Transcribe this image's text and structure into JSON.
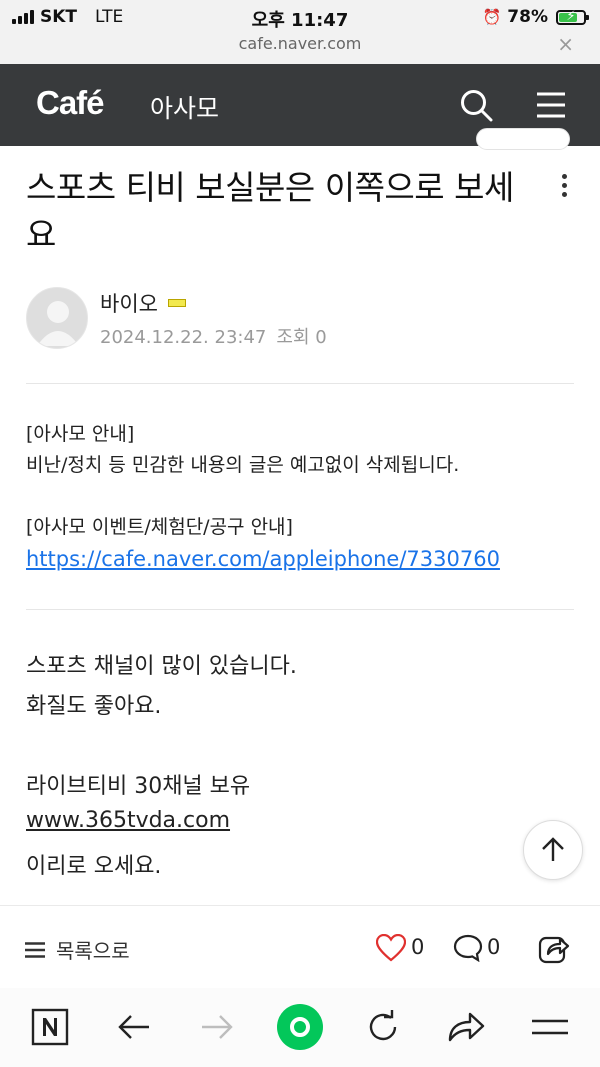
{
  "status_bar": {
    "carrier": "SKT",
    "network": "LTE",
    "time": "오후 11:47",
    "battery": "78%",
    "battery_level": 0.78
  },
  "url_bar": {
    "url": "cafe.naver.com",
    "close": "×"
  },
  "header": {
    "logo": "Café",
    "cafe_name": "아사모",
    "icons": [
      "search-icon",
      "menu-icon"
    ]
  },
  "post": {
    "title": "스포츠 티비 보실분은 이쪽으로 보세요",
    "author": "바이오",
    "date": "2024.12.22. 23:47",
    "views": "조회 0",
    "notice": {
      "line1": "[아사모 안내]",
      "line2": "비난/정치 등 민감한 내용의 글은 예고없이 삭제됩니다.",
      "line3": "[아사모 이벤트/체험단/공구 안내]",
      "link": "https://cafe.naver.com/appleiphone/7330760"
    },
    "body": {
      "line1": "스포츠 채널이 많이 있습니다.",
      "line2": "화질도 좋아요.",
      "line3": "라이브티비 30채널 보유",
      "link": "www.365tvda.com",
      "line4": "이리로 오세요."
    }
  },
  "actions": {
    "list_label": "목록으로",
    "like_count": "0",
    "comment_count": "0"
  },
  "browser_toolbar": {
    "icons": [
      "naver-icon",
      "back-icon",
      "forward-icon",
      "green-dot-icon",
      "refresh-icon",
      "share-icon",
      "menu-icon"
    ]
  },
  "colors": {
    "header_bg": "#383a3c",
    "link": "#1a73e8",
    "like_heart": "#e0312f",
    "green": "#03c75a"
  }
}
